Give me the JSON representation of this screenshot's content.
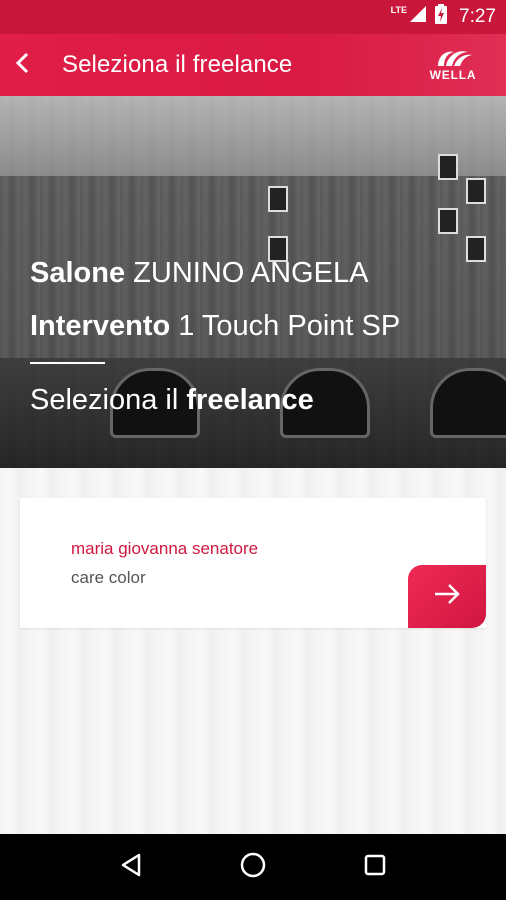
{
  "status_bar": {
    "network": "LTE",
    "time": "7:27",
    "icons": [
      "signal-icon",
      "battery-charging-icon"
    ]
  },
  "app_bar": {
    "title": "Seleziona il freelance",
    "back_icon": "chevron-left-icon",
    "logo_text": "WELLA"
  },
  "hero": {
    "salon_label": "Salone",
    "salon_value": "ZUNINO ANGELA",
    "service_label": "Intervento",
    "service_value": "1 Touch Point SP",
    "select_prefix": "Seleziona il",
    "select_emphasis": "freelance"
  },
  "freelancers": [
    {
      "name": "maria giovanna senatore",
      "role": "care color",
      "action_icon": "arrow-right-icon"
    }
  ],
  "nav_bar": {
    "icons": [
      "back-triangle-icon",
      "home-circle-icon",
      "recents-square-icon"
    ]
  },
  "colors": {
    "accent": "#e01e48",
    "status_bar": "#c8173b",
    "name_text": "#d0183f"
  }
}
